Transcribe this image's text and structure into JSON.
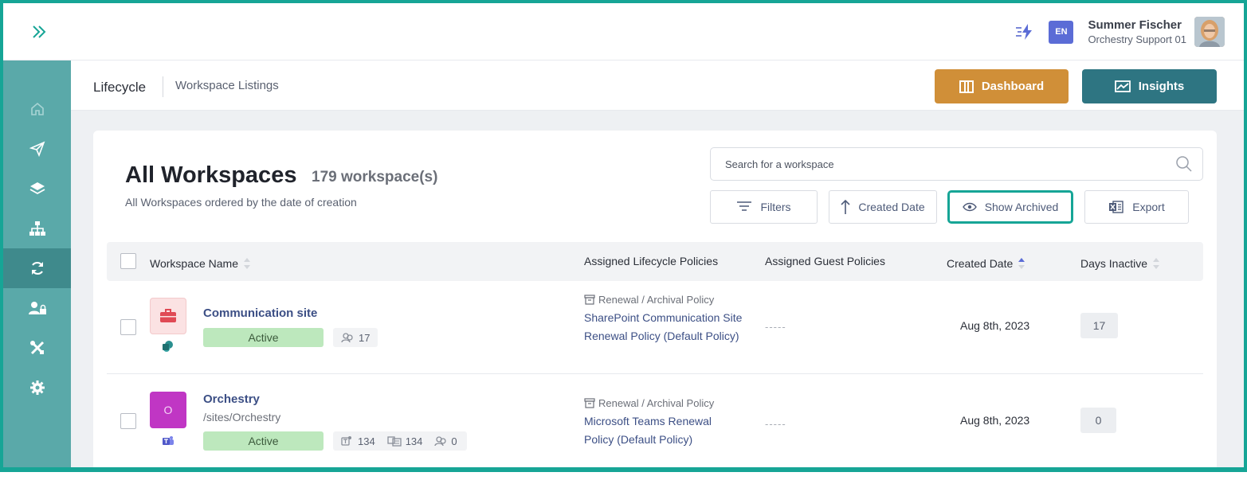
{
  "colors": {
    "accent": "#16a596",
    "sidebar": "#5aa9a9",
    "dashboard": "#d08f38",
    "insights": "#2e7582",
    "active_badge": "#bde8bd",
    "link": "#3c4f85"
  },
  "topbar": {
    "expand_icon": "double-chevron-right-icon",
    "quick_icon": "lightning-icon",
    "language": "EN",
    "user": {
      "name": "Summer Fischer",
      "org": "Orchestry Support 01"
    }
  },
  "sidebar": {
    "items": [
      {
        "icon": "home-icon"
      },
      {
        "icon": "send-icon"
      },
      {
        "icon": "layers-icon"
      },
      {
        "icon": "org-chart-icon"
      },
      {
        "icon": "refresh-icon",
        "active": true
      },
      {
        "icon": "user-lock-icon"
      },
      {
        "icon": "tools-icon"
      },
      {
        "icon": "gear-icon"
      }
    ]
  },
  "breadcrumb": {
    "section": "Lifecycle",
    "page": "Workspace Listings"
  },
  "header_buttons": {
    "dashboard": "Dashboard",
    "insights": "Insights"
  },
  "main": {
    "title": "All Workspaces",
    "count": "179 workspace(s)",
    "subtitle": "All Workspaces ordered by the date of creation",
    "search_placeholder": "Search for a workspace",
    "toolbar": {
      "filters": "Filters",
      "sort": "Created Date",
      "archived": "Show Archived",
      "export": "Export"
    }
  },
  "table": {
    "headers": {
      "name": "Workspace Name",
      "lifecycle": "Assigned Lifecycle Policies",
      "guest": "Assigned Guest Policies",
      "created": "Created Date",
      "inactive": "Days Inactive"
    },
    "rows": [
      {
        "name": "Communication site",
        "icon": "briefcase-icon",
        "type_icon": "sharepoint-icon",
        "status": "Active",
        "stats": [
          "17"
        ],
        "policy_type": "Renewal / Archival Policy",
        "policy_name": "SharePoint Communication Site Renewal Policy (Default Policy)",
        "guest_policy": "-----",
        "created": "Aug 8th, 2023",
        "days_inactive": "17"
      },
      {
        "name": "Orchestry",
        "url": "/sites/Orchestry",
        "icon_letter": "O",
        "type_icon": "teams-icon",
        "status": "Active",
        "stats": [
          "134",
          "134",
          "0"
        ],
        "policy_type": "Renewal / Archival Policy",
        "policy_name": "Microsoft Teams Renewal Policy (Default Policy)",
        "guest_policy": "-----",
        "created": "Aug 8th, 2023",
        "days_inactive": "0"
      }
    ]
  }
}
